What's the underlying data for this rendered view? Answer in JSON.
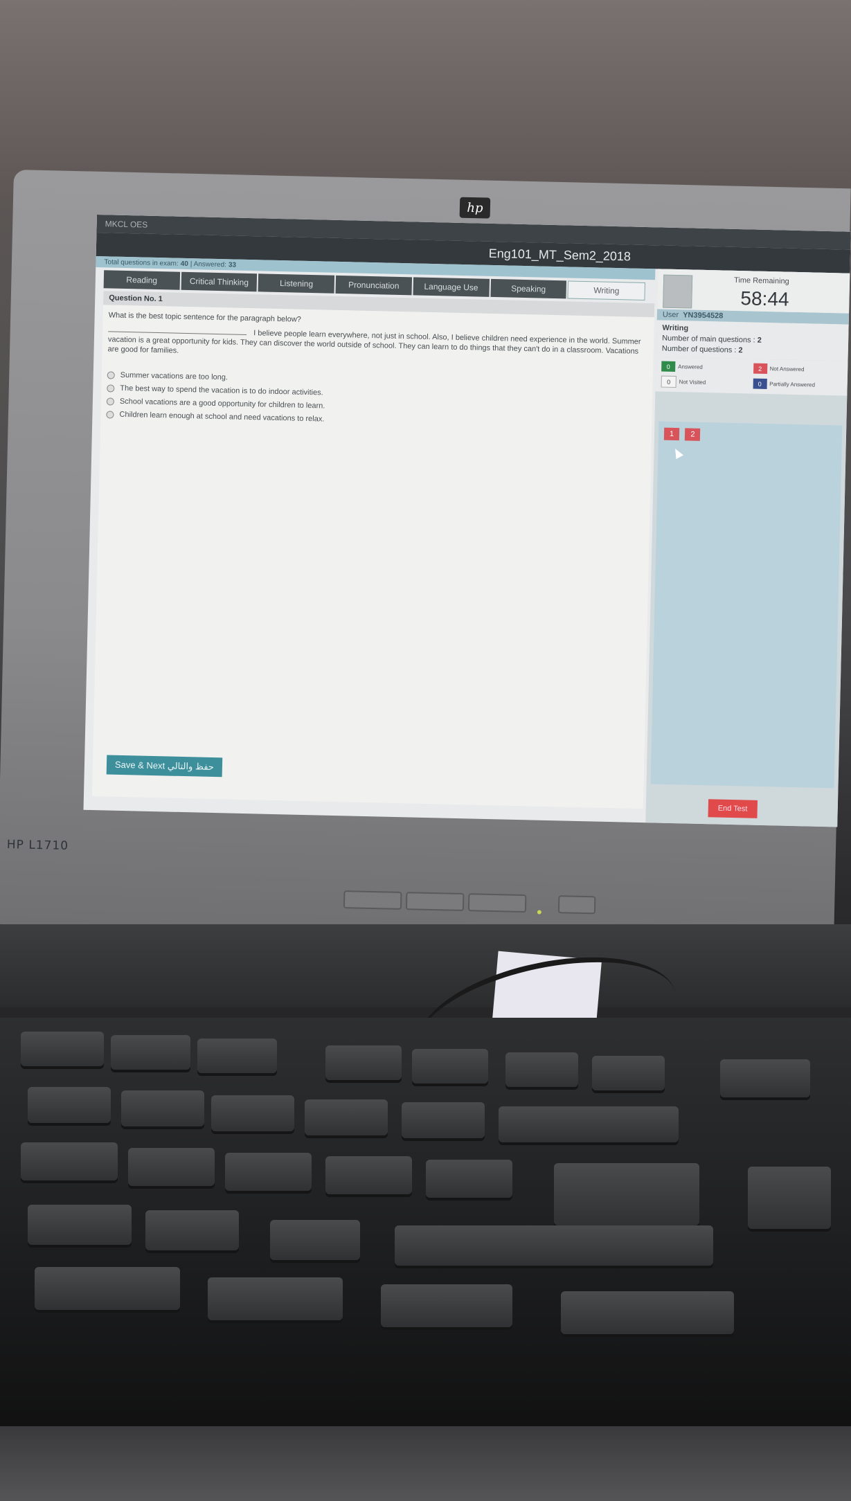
{
  "monitor": {
    "brand_logo": "hp",
    "model_label": "HP L1710"
  },
  "app": {
    "top_label": "MKCL OES",
    "exam_title": "Eng101_MT_Sem2_2018"
  },
  "summary": {
    "total_label": "Total questions in exam:",
    "total_value": "40",
    "answered_label": "| Answered:",
    "answered_value": "33"
  },
  "tabs": [
    {
      "label": "Reading"
    },
    {
      "label": "Critical Thinking"
    },
    {
      "label": "Listening"
    },
    {
      "label": "Pronunciation"
    },
    {
      "label": "Language Use"
    },
    {
      "label": "Speaking"
    },
    {
      "label": "Writing"
    }
  ],
  "question": {
    "number_label": "Question No. 1",
    "prompt": "What is the best topic sentence for the paragraph below?",
    "paragraph": "I believe people learn everywhere, not just in school. Also, I believe children need experience in the world. Summer vacation is a great opportunity for kids. They can discover the world outside of school. They can learn to do things that they can't do in a classroom. Vacations are good for families.",
    "options": [
      {
        "text": "Summer vacations are too long."
      },
      {
        "text": "The best way to spend the vacation is to do indoor activities."
      },
      {
        "text": "School vacations are a good opportunity for children to learn."
      },
      {
        "text": "Children learn enough at school and need vacations to relax."
      }
    ]
  },
  "actions": {
    "save_next_label": "Save & Next حفظ والتالي",
    "end_test_label": "End Test"
  },
  "sidebar": {
    "time_label": "Time Remaining",
    "time_value": "58:44",
    "user_label": "User",
    "user_id": "YN3954528",
    "section_name": "Writing",
    "main_questions_label": "Number of main questions :",
    "main_questions_value": "2",
    "questions_label": "Number of questions :",
    "questions_value": "2",
    "legend": [
      {
        "count": "0",
        "label": "Answered",
        "color": "#2e8b4a"
      },
      {
        "count": "2",
        "label": "Not Answered",
        "color": "#d9535a"
      },
      {
        "count": "0",
        "label": "Not Visited",
        "color": "#f4f4f4"
      },
      {
        "count": "0",
        "label": "Partially Answered",
        "color": "#3a4f8f"
      }
    ],
    "question_buttons": [
      {
        "label": "1"
      },
      {
        "label": "2"
      }
    ]
  }
}
